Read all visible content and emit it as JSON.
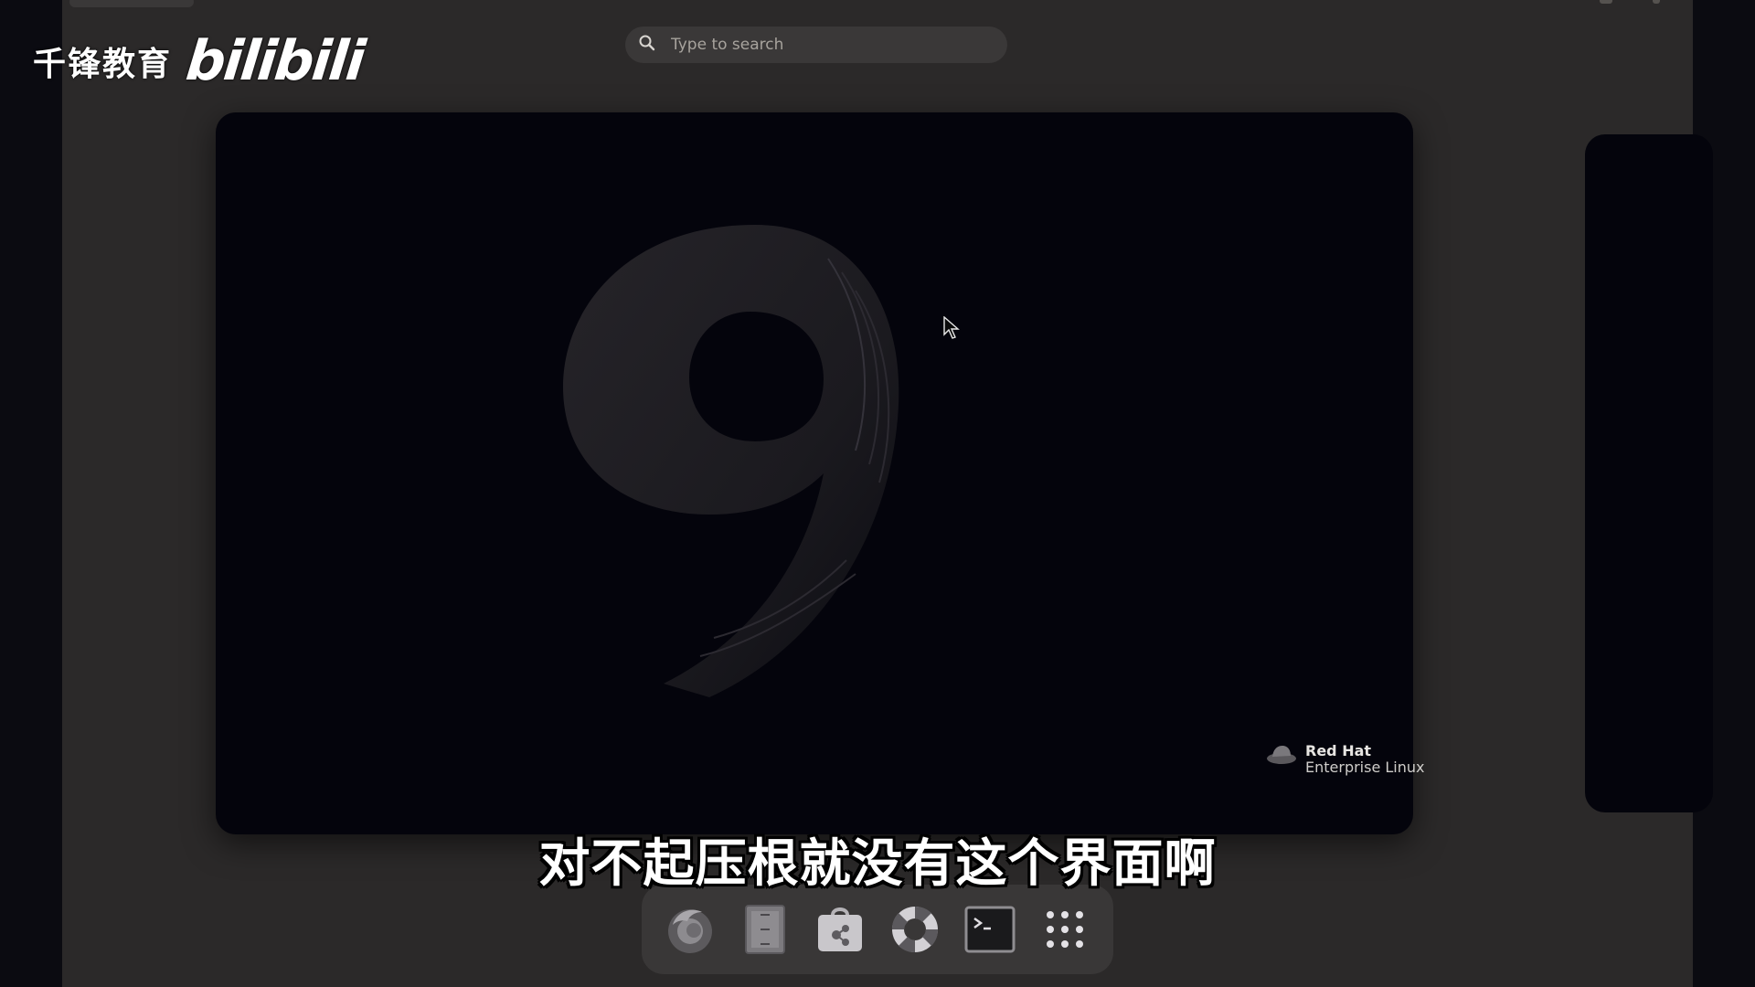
{
  "search": {
    "placeholder": "Type to search",
    "icon": "search-icon"
  },
  "workspace": {
    "wallpaper": {
      "glyph": "9"
    },
    "branding": {
      "line1": "Red Hat",
      "line2": "Enterprise Linux"
    }
  },
  "dash": {
    "items": [
      {
        "name": "firefox",
        "icon": "firefox-icon"
      },
      {
        "name": "files",
        "icon": "files-icon"
      },
      {
        "name": "software",
        "icon": "software-store-icon"
      },
      {
        "name": "help",
        "icon": "help-lifebuoy-icon"
      },
      {
        "name": "terminal",
        "icon": "terminal-icon"
      },
      {
        "name": "show-applications",
        "icon": "app-grid-icon"
      }
    ]
  },
  "watermark": {
    "brand": "千锋教育",
    "site": "bilibili"
  },
  "subtitle": "对不起压根就没有这个界面啊",
  "colors": {
    "overview_bg": "#2b2929",
    "workspace_bg": "#04040c",
    "dash_bg": "#393737",
    "search_bg": "#3a3838"
  }
}
